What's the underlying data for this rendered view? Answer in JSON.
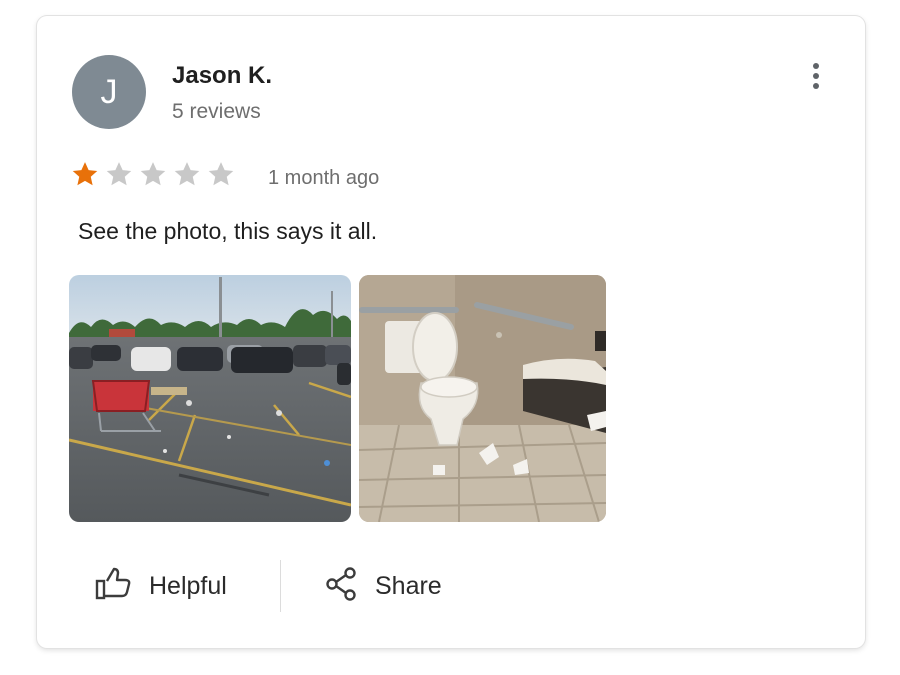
{
  "review": {
    "author": {
      "initial": "J",
      "name": "Jason K.",
      "review_count": "5 reviews",
      "avatar_color": "#7f8a93"
    },
    "rating": 1,
    "rating_max": 5,
    "star_filled_color": "#e8710a",
    "star_empty_color": "#c8c8c8",
    "time": "1 month ago",
    "text": "See the photo, this says it all.",
    "photos": [
      {
        "icon": "parking-lot-photo"
      },
      {
        "icon": "restroom-photo"
      }
    ]
  },
  "actions": {
    "helpful_label": "Helpful",
    "share_label": "Share"
  }
}
